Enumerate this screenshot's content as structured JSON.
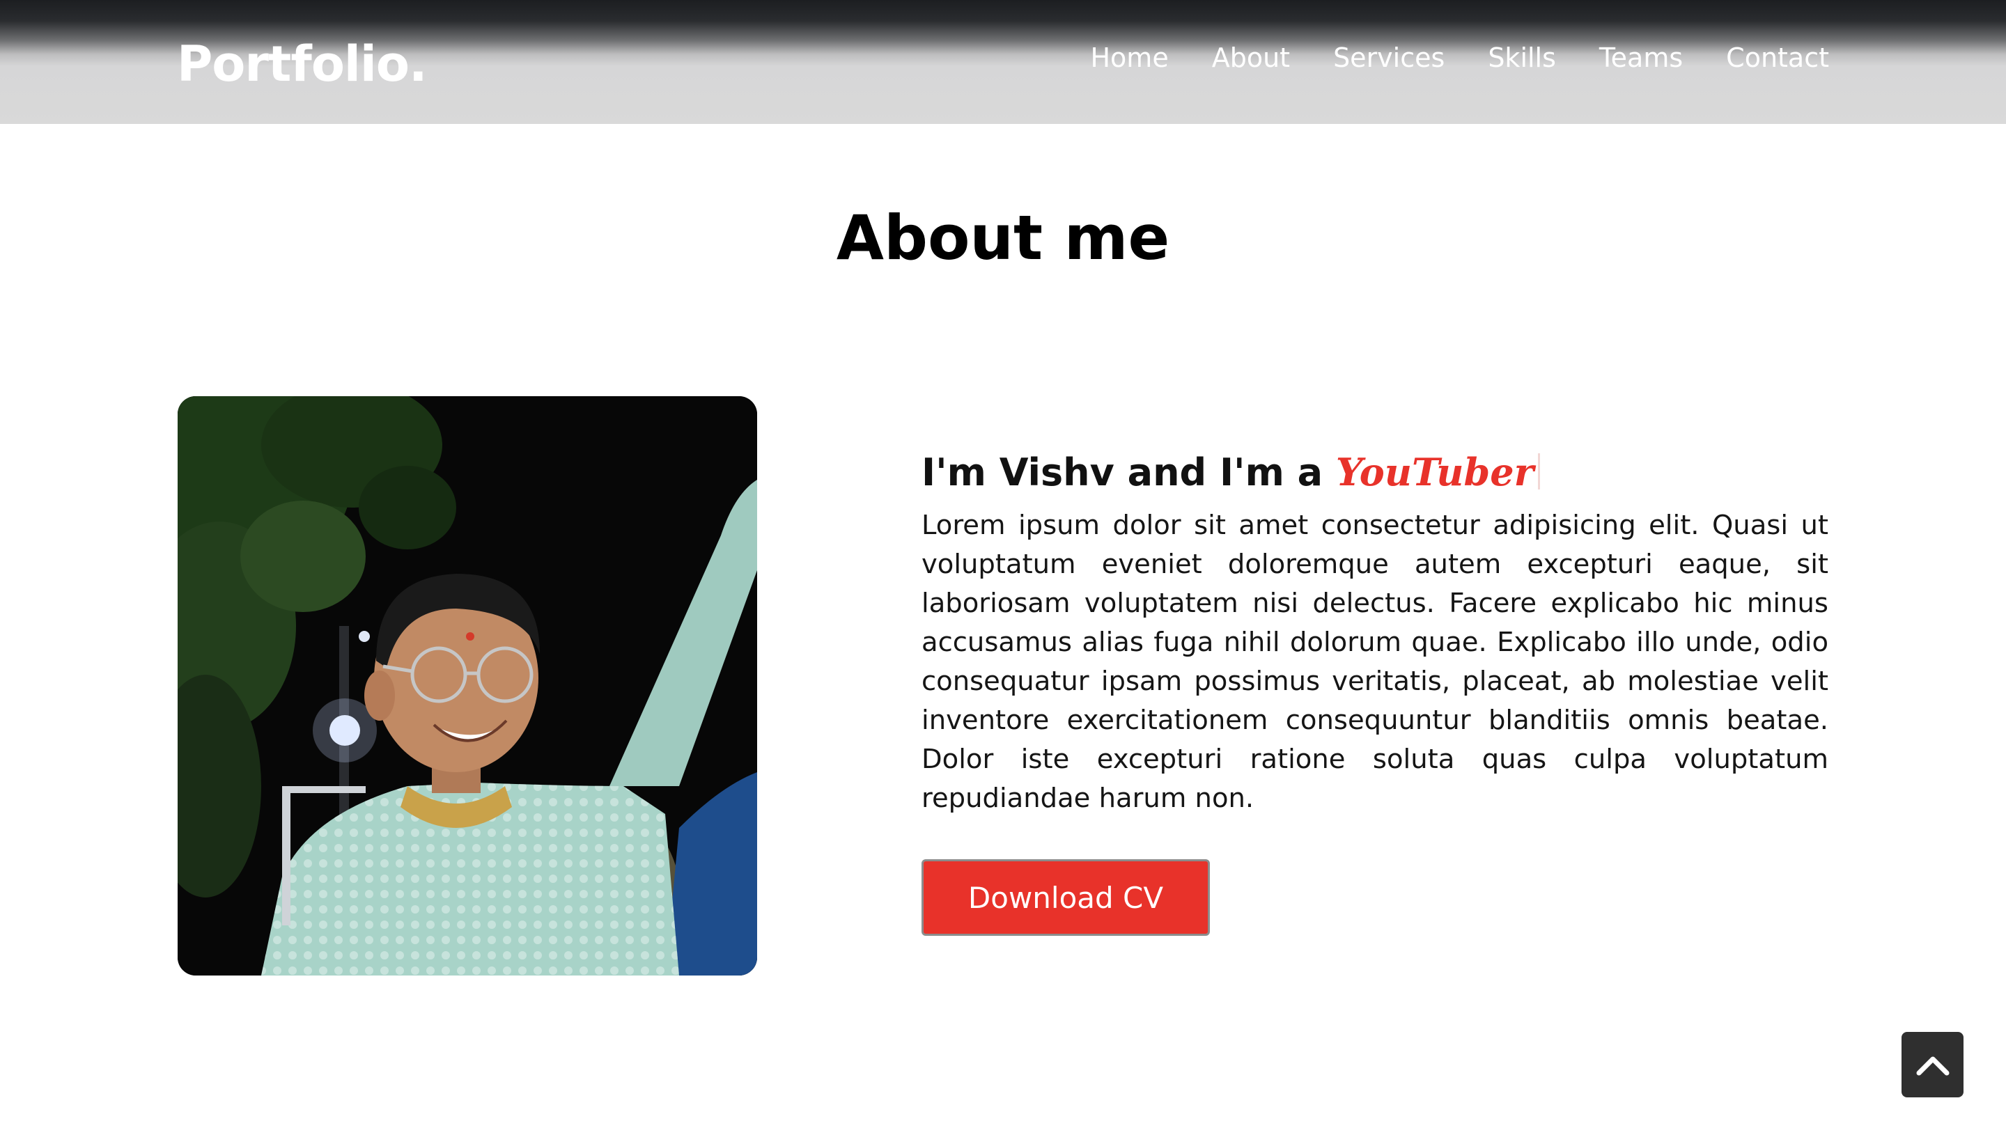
{
  "header": {
    "logo": "Portfolio.",
    "nav": [
      {
        "label": "Home"
      },
      {
        "label": "About"
      },
      {
        "label": "Services"
      },
      {
        "label": "Skills"
      },
      {
        "label": "Teams"
      },
      {
        "label": "Contact"
      }
    ]
  },
  "about": {
    "title": "About me",
    "headline_prefix": "I'm Vishv and I'm a ",
    "typed_word": "YouTuber",
    "paragraph": "Lorem ipsum dolor sit amet consectetur adipisicing elit. Quasi ut voluptatum eveniet doloremque autem excepturi eaque, sit laboriosam voluptatem nisi delectus. Facere explicabo hic minus accusamus alias fuga nihil dolorum quae. Explicabo illo unde, odio consequatur ipsam possimus veritatis, placeat, ab molestiae velit inventore exercitationem consequuntur blanditiis omnis beatae. Dolor iste excepturi ratione soluta quas culpa voluptatum repudiandae harum non.",
    "button_label": "Download CV"
  },
  "colors": {
    "accent": "#e8322a",
    "navbar": "#d9d9d9",
    "text": "#111111"
  },
  "icons": {
    "scroll_top": "chevron-up-icon"
  }
}
